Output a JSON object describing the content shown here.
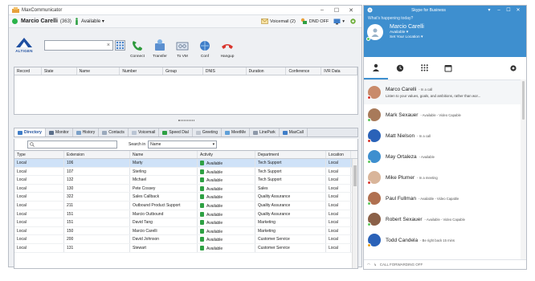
{
  "colors": {
    "brand_blue": "#3e8fcf",
    "available_green": "#2bb34a",
    "selected_row": "#cfe2f8",
    "busy_red": "#d9362e"
  },
  "mc": {
    "title": "MaxCommunicator",
    "user_name": "Marcio Carelli",
    "user_ext": "(363)",
    "presence": "Available",
    "voicemail_label": "Voicemail (2)",
    "dnd_label": "DND OFF",
    "logo_text": "ALTIGEN",
    "dial_clear": "×",
    "toolbar": [
      {
        "label": "Connect",
        "icon": "phone-connect-icon"
      },
      {
        "label": "Transfer",
        "icon": "transfer-icon"
      },
      {
        "label": "To VM",
        "icon": "to-vm-icon"
      },
      {
        "label": "Conf",
        "icon": "conference-icon"
      },
      {
        "label": "Hangup",
        "icon": "hangup-icon"
      }
    ],
    "call_columns": [
      "Record",
      "State",
      "Name",
      "Number",
      "Group",
      "DNIS",
      "Duration",
      "Conference",
      "IVR Data"
    ],
    "tabs": [
      "Directory",
      "Monitor",
      "History",
      "Contacts",
      "Voicemail",
      "Speed Dial",
      "Greeting",
      "MeetMe",
      "LinePark",
      "MaxCall"
    ],
    "search_in_label": "Search in",
    "search_in_value": "Name",
    "dir_columns": [
      "Type",
      "Extension",
      "Name",
      "Activity",
      "Department",
      "Location"
    ],
    "dir_rows": [
      [
        "Local",
        "106",
        "Marty",
        "Available",
        "Tech Support",
        "Local"
      ],
      [
        "Local",
        "107",
        "Sterling",
        "Available",
        "Tech Support",
        "Local"
      ],
      [
        "Local",
        "132",
        "Michael",
        "Available",
        "Tech Support",
        "Local"
      ],
      [
        "Local",
        "130",
        "Pete Cossey",
        "Available",
        "Sales",
        "Local"
      ],
      [
        "Local",
        "322",
        "Sales Callback",
        "Available",
        "Quality Assurance",
        "Local"
      ],
      [
        "Local",
        "211",
        "Outbound Product Support",
        "Available",
        "Quality Assurance",
        "Local"
      ],
      [
        "Local",
        "151",
        "Marcio Outbound",
        "Available",
        "Quality Assurance",
        "Local"
      ],
      [
        "Local",
        "151",
        "David Tang",
        "Available",
        "Marketing",
        "Local"
      ],
      [
        "Local",
        "150",
        "Marcio Carelli",
        "Available",
        "Marketing",
        "Local"
      ],
      [
        "Local",
        "200",
        "David Johnson",
        "Available",
        "Customer Service",
        "Local"
      ],
      [
        "Local",
        "131",
        "Stewart",
        "Available",
        "Customer Service",
        "Local"
      ]
    ]
  },
  "sfb": {
    "title": "Skype for Business",
    "whats_happening": "What's happening today?",
    "me": {
      "name": "Marcio Carelli",
      "status": "Available ▾",
      "location": "Set Your Location ▾"
    },
    "contacts": [
      {
        "name": "Marco Carelli",
        "status": "- In a call",
        "note": "Listen to your values, goals, and ambitions, rather than wor...",
        "color": "#d9362e",
        "av": "#c98b6b"
      },
      {
        "name": "Mark Sexauer",
        "status": "- Available - Video Capable",
        "note": "",
        "color": "#5cc85c",
        "av": "#a87a5a"
      },
      {
        "name": "Matt Nielson",
        "status": "- In a call",
        "note": "",
        "color": "#d9362e",
        "av": "#2a62b8"
      },
      {
        "name": "May Ortaleza",
        "status": "- Available",
        "note": "",
        "color": "#5cc85c",
        "av": "#3e8fcf"
      },
      {
        "name": "Mike Plumer",
        "status": "- In a meeting",
        "note": "",
        "color": "#d9362e",
        "av": "#d9b59a"
      },
      {
        "name": "Paul Fullman",
        "status": "- Available - Video Capable",
        "note": "",
        "color": "#5cc85c",
        "av": "#b07050"
      },
      {
        "name": "Robert Sexauer",
        "status": "- Available - Video Capable",
        "note": "",
        "color": "#5cc85c",
        "av": "#8a6048"
      },
      {
        "name": "Todd Candela",
        "status": "- Be right back 15 mins",
        "note": "",
        "color": "#e8a019",
        "av": "#2a62b8"
      }
    ],
    "bottom_label": "CALL FORWARDING OFF"
  }
}
